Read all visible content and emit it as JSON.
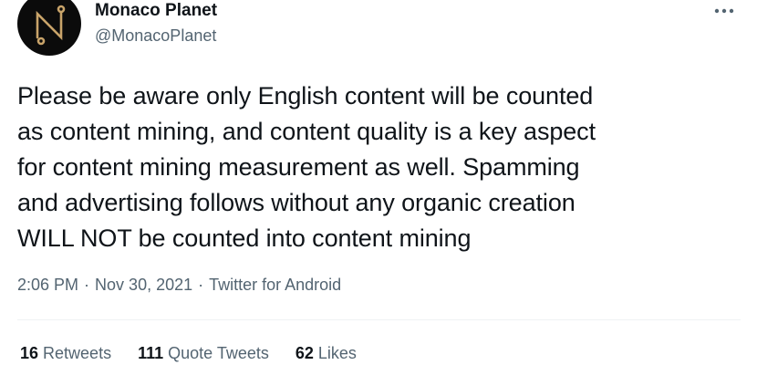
{
  "user": {
    "display_name": "Monaco Planet",
    "handle": "@MonacoPlanet",
    "avatar_icon": "monaco-planet-logo"
  },
  "more_icon": "more-horizontal-icon",
  "tweet": {
    "lines": [
      "Please be aware only English content will be counted",
      "as content mining, and content quality is a key aspect",
      "for content mining measurement as well. Spamming",
      "and advertising follows without any organic creation",
      "WILL NOT be counted into content mining"
    ]
  },
  "meta": {
    "time": "2:06 PM",
    "date": "Nov 30, 2021",
    "separator": "·",
    "source": "Twitter for Android"
  },
  "stats": {
    "retweets": {
      "count": "16",
      "label": "Retweets"
    },
    "quotes": {
      "count": "111",
      "label": "Quote Tweets"
    },
    "likes": {
      "count": "62",
      "label": "Likes"
    }
  },
  "colors": {
    "text_primary": "#0f1419",
    "text_secondary": "#536471",
    "divider": "#eff3f4",
    "avatar_bg": "#0b0b0b",
    "logo_accent": "#c9a46a"
  }
}
